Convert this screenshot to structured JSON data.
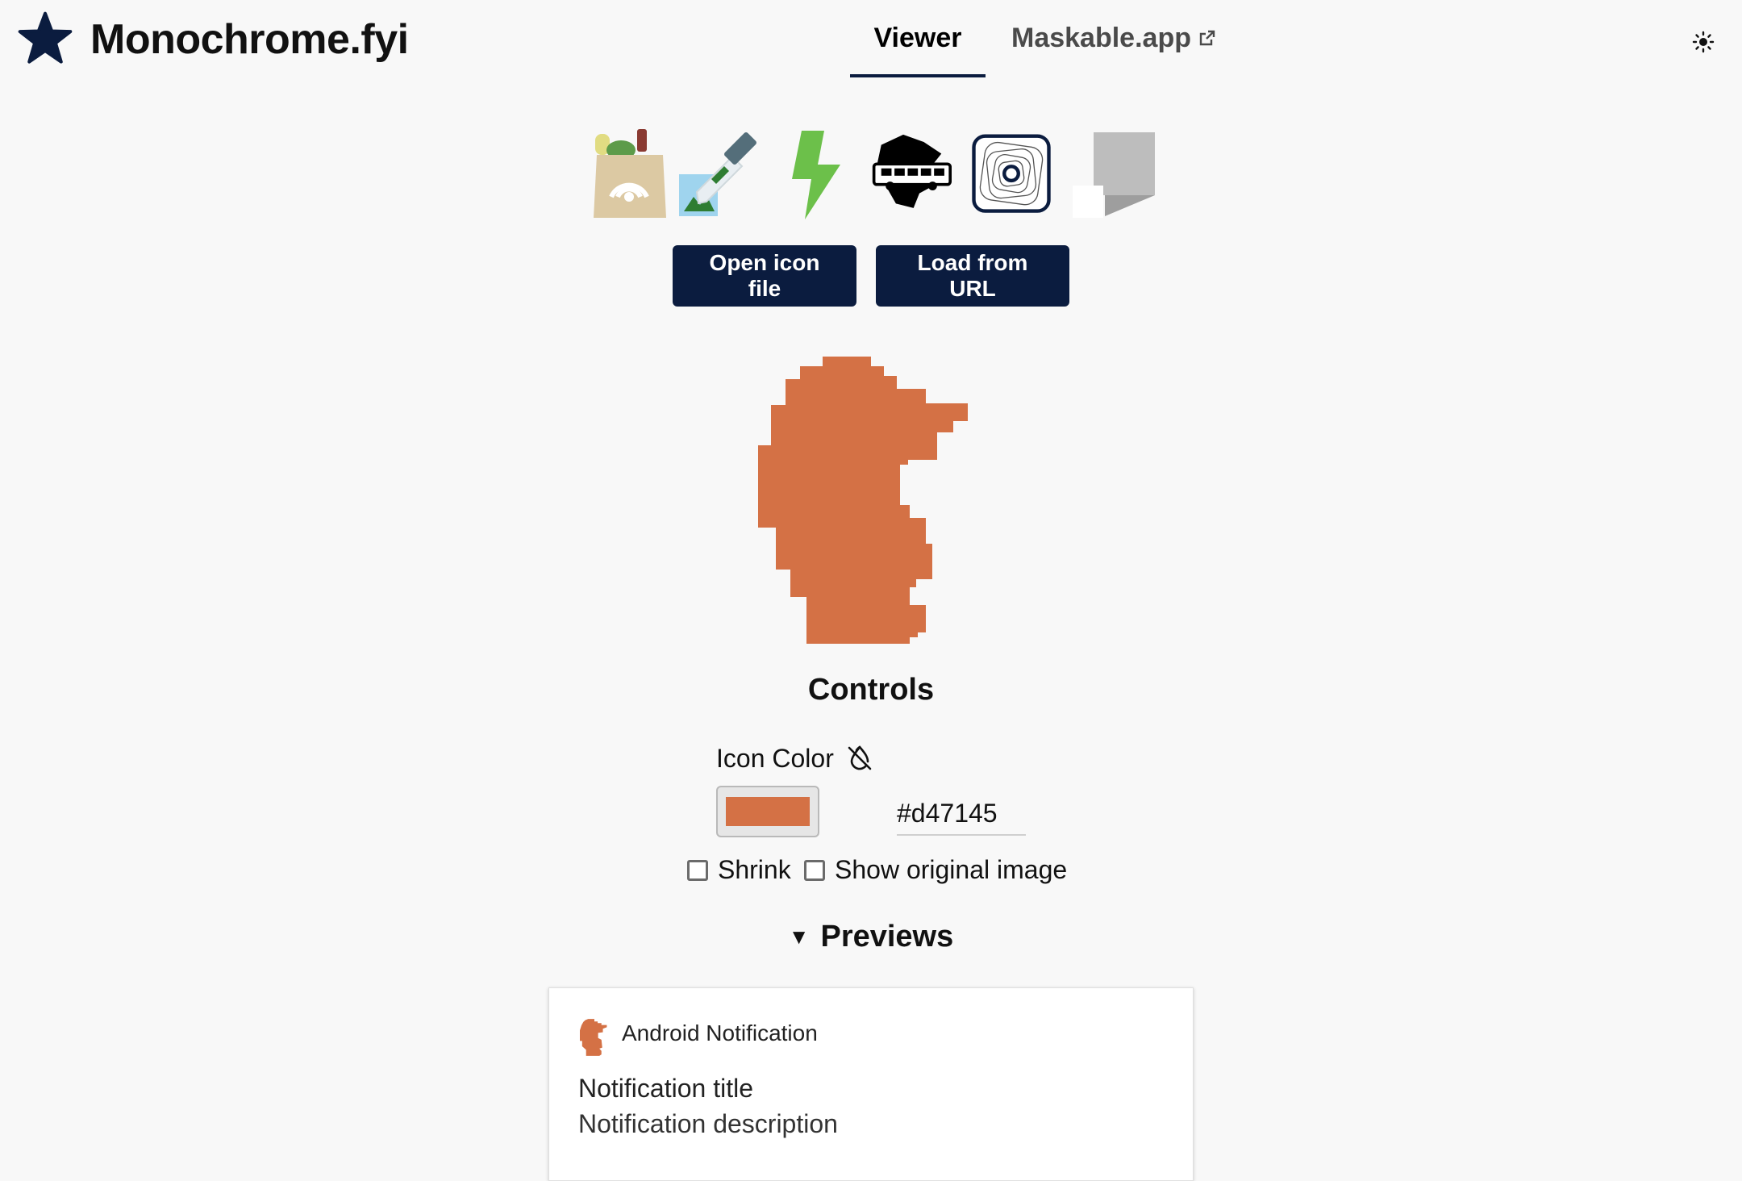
{
  "header": {
    "site_title": "Monochrome.fyi",
    "logo_icon": "star-icon",
    "tabs": [
      {
        "label": "Viewer",
        "active": true
      },
      {
        "label": "Maskable.app",
        "active": false,
        "external": true
      }
    ],
    "theme_toggle_icon": "sun-icon"
  },
  "samples": {
    "icons": [
      "grocery-bag-icon",
      "eyedropper-image-icon",
      "lightning-bolt-icon",
      "island-bus-icon",
      "concentric-squares-icon",
      "folded-paper-icon"
    ],
    "selected": "concentric-squares-icon"
  },
  "actions": {
    "open_label": "Open icon file",
    "url_label": "Load from URL"
  },
  "controls": {
    "heading": "Controls",
    "icon_color_label": "Icon Color",
    "no_color_icon": "droplet-off-icon",
    "color_value": "#d47145",
    "shrink_label": "Shrink",
    "original_label": "Show original image",
    "shrink_checked": false,
    "original_checked": false
  },
  "previews": {
    "heading": "Previews",
    "notification": {
      "app_name": "Android Notification",
      "title": "Notification title",
      "description": "Notification description"
    }
  },
  "colors": {
    "accent": "#0b1c3f",
    "icon": "#d47145",
    "background": "#f8f8f8"
  }
}
